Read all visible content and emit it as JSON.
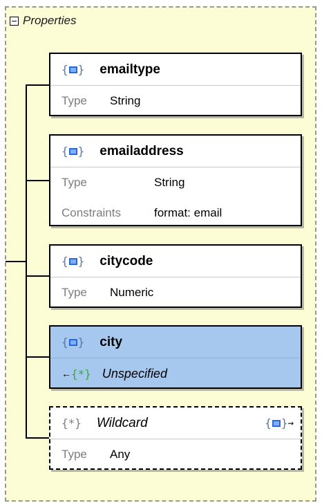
{
  "header": {
    "title": "Properties"
  },
  "cards": [
    {
      "name": "emailtype",
      "rows": [
        {
          "key": "Type",
          "value": "String"
        }
      ]
    },
    {
      "name": "emailaddress",
      "rows": [
        {
          "key": "Type",
          "value": "String"
        },
        {
          "key": "Constraints",
          "value": "format: email"
        }
      ]
    },
    {
      "name": "citycode",
      "rows": [
        {
          "key": "Type",
          "value": "Numeric"
        }
      ]
    },
    {
      "name": "city",
      "unspecified": "Unspecified",
      "selected": true
    },
    {
      "name": "Wildcard",
      "rows": [
        {
          "key": "Type",
          "value": "Any"
        }
      ]
    }
  ],
  "icons": {
    "object": "object-brace-icon",
    "wildcard": "wildcard-star-icon",
    "arrow": "arrow-icon"
  },
  "colors": {
    "panel_bg": "#fcfcd5",
    "selected_bg": "#a7c8ee",
    "icon_blue": "#2a67d8",
    "star_green": "#3aa83a"
  }
}
